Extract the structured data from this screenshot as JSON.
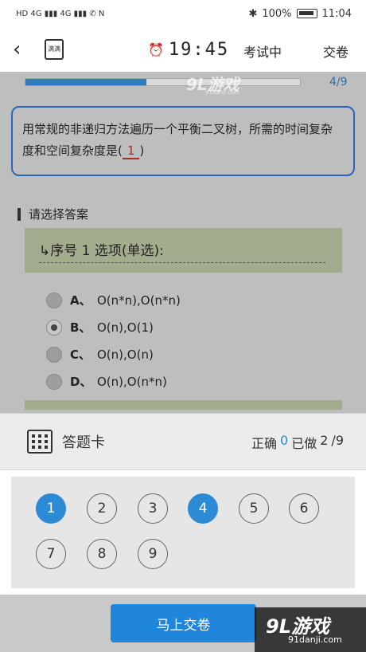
{
  "statusbar": {
    "left": "HD 4G ▮▮▮ 4G ▮▮▮ ✆ N",
    "bt": "✱",
    "battery_text": "100%",
    "time": "11:04"
  },
  "header": {
    "back_glyph": "‹",
    "app_icon_label": "满满",
    "clock_glyph": "⏰",
    "timer": "19:45",
    "status": "考试中",
    "submit": "交卷"
  },
  "progress": {
    "fraction": 0.44,
    "text": "4/9",
    "watermark": "9L游戏",
    "watermark_sub": "91danji.com"
  },
  "question": {
    "text": "用常规的非递归方法遍历一个平衡二叉树，所需的时间复杂度和空间复杂度是(",
    "blank": "1",
    "close": ")"
  },
  "section": {
    "title": "请选择答案",
    "option_header": "↳序号 1 选项(单选):"
  },
  "options": [
    {
      "letter": "A、",
      "text": "O(n*n),O(n*n)",
      "selected": false
    },
    {
      "letter": "B、",
      "text": "O(n),O(1)",
      "selected": true
    },
    {
      "letter": "C、",
      "text": "O(n),O(n)",
      "selected": false
    },
    {
      "letter": "D、",
      "text": "O(n),O(n*n)",
      "selected": false
    }
  ],
  "answer_card": {
    "label": "答题卡",
    "correct_prefix": "正确",
    "correct_count": "0",
    "done_prefix": "已做",
    "done_count": "2",
    "total": "/9"
  },
  "numbers": [
    {
      "n": "1",
      "done": true
    },
    {
      "n": "2",
      "done": false
    },
    {
      "n": "3",
      "done": false
    },
    {
      "n": "4",
      "done": true
    },
    {
      "n": "5",
      "done": false
    },
    {
      "n": "6",
      "done": false
    },
    {
      "n": "7",
      "done": false
    },
    {
      "n": "8",
      "done": false
    },
    {
      "n": "9",
      "done": false
    }
  ],
  "bottom": {
    "submit_now": "马上交卷",
    "watermark": "9L游戏",
    "watermark_sub": "91danji.com"
  },
  "colors": {
    "accent": "#2d8bd6",
    "question_border": "#2a64b7",
    "blank": "#a82a2a"
  }
}
